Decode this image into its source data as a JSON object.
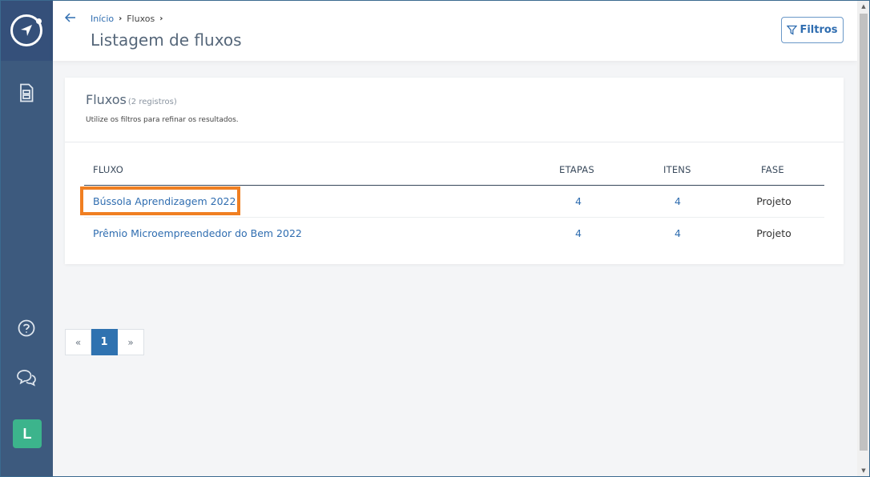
{
  "sidebar": {
    "logo_icon": "compass-logo-icon",
    "nav_icon": "document-list-icon",
    "help_icon": "help-circle-icon",
    "chat_icon": "chat-bubbles-icon",
    "avatar_letter": "L",
    "avatar_color": "#3cb48c",
    "background": "#3d5a7e"
  },
  "header": {
    "back_icon": "arrow-left-icon",
    "breadcrumb": {
      "home": "Início",
      "separator": "›",
      "current": "Fluxos"
    },
    "title": "Listagem de fluxos",
    "filters_button": "Filtros",
    "filters_icon": "filter-icon"
  },
  "card": {
    "title": "Fluxos",
    "count": "(2 registros)",
    "subtitle": "Utilize os filtros para refinar os resultados."
  },
  "table": {
    "columns": [
      "FLUXO",
      "ETAPAS",
      "ITENS",
      "FASE"
    ],
    "rows": [
      {
        "fluxo": "Bússola Aprendizagem 2022",
        "etapas": "4",
        "itens": "4",
        "fase": "Projeto"
      },
      {
        "fluxo": "Prêmio Microempreendedor do Bem 2022",
        "etapas": "4",
        "itens": "4",
        "fase": "Projeto"
      }
    ]
  },
  "pagination": {
    "prev": "«",
    "current": "1",
    "next": "»"
  },
  "accent_color": "#2f6db0",
  "highlight_color": "#f07f22"
}
